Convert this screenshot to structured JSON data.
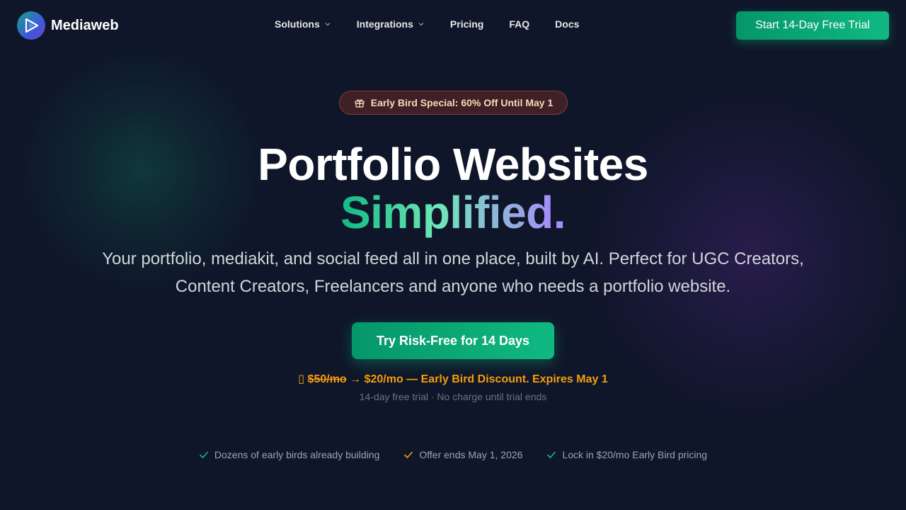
{
  "brand": {
    "name": "Mediaweb"
  },
  "nav": {
    "items": [
      {
        "label": "Solutions",
        "dropdown": true
      },
      {
        "label": "Integrations",
        "dropdown": true
      },
      {
        "label": "Pricing",
        "dropdown": false
      },
      {
        "label": "FAQ",
        "dropdown": false
      },
      {
        "label": "Docs",
        "dropdown": false
      }
    ],
    "cta_label": "Start 14-Day Free Trial"
  },
  "hero": {
    "badge_label": "Early Bird Special: 60% Off Until May 1",
    "title_line1": "Portfolio Websites",
    "title_line2": "Simplified",
    "title_dot": ".",
    "subtitle": "Your portfolio, mediakit, and social feed all in one place, built by AI. Perfect for UGC Creators, Content Creators, Freelancers and anyone who needs a portfolio website.",
    "cta_label": "Try Risk-Free for 14 Days",
    "offer": {
      "glyph": "▯",
      "old_price": "$50/mo",
      "rest": "→ $20/mo — Early Bird Discount. Expires May 1"
    },
    "trial_note": "14-day free trial · No charge until trial ends"
  },
  "features": [
    {
      "label": "Dozens of early birds already building",
      "check_color": "#10b981"
    },
    {
      "label": "Offer ends May 1, 2026",
      "check_color": "#f59e0b"
    },
    {
      "label": "Lock in $20/mo Early Bird pricing",
      "check_color": "#10b981"
    }
  ],
  "colors": {
    "background": "#0f1629",
    "accent_green": "#10b981",
    "accent_orange": "#f59e0b",
    "accent_purple": "#a78bfa"
  },
  "icons": {
    "logo": "play-logo-icon",
    "badge": "gift-icon",
    "dropdown": "chevron-down-icon",
    "feature": "check-icon"
  }
}
